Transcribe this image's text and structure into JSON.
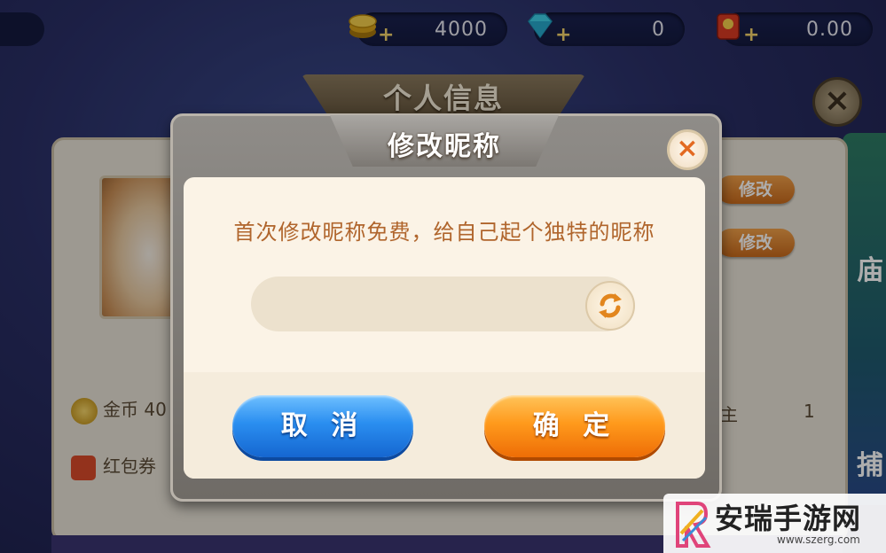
{
  "topbar": {
    "gold": {
      "value": "4000",
      "icon": "gold-coin-icon"
    },
    "diamond": {
      "value": "0",
      "icon": "diamond-icon"
    },
    "redpacket": {
      "value": "0.00",
      "icon": "red-packet-icon"
    }
  },
  "back_panel": {
    "title": "个人信息",
    "edit_label_1": "修改",
    "edit_label_2": "修改",
    "gold_label": "金币 40",
    "redpacket_label": "红包券",
    "right_text": "主",
    "right_value": "1",
    "side_text_1": "庙",
    "side_text_2": "捕"
  },
  "dialog": {
    "title": "修改昵称",
    "prompt": "首次修改昵称免费，给自己起个独特的昵称",
    "name_value": "",
    "cancel_label": "取 消",
    "confirm_label": "确 定"
  },
  "watermark": {
    "name": "安瑞手游网",
    "url": "www.szerg.com"
  },
  "colors": {
    "cancel_button": "#2a8ef0",
    "confirm_button": "#ff9a1c",
    "prompt_text": "#b0652c",
    "close_x": "#e36a22"
  }
}
